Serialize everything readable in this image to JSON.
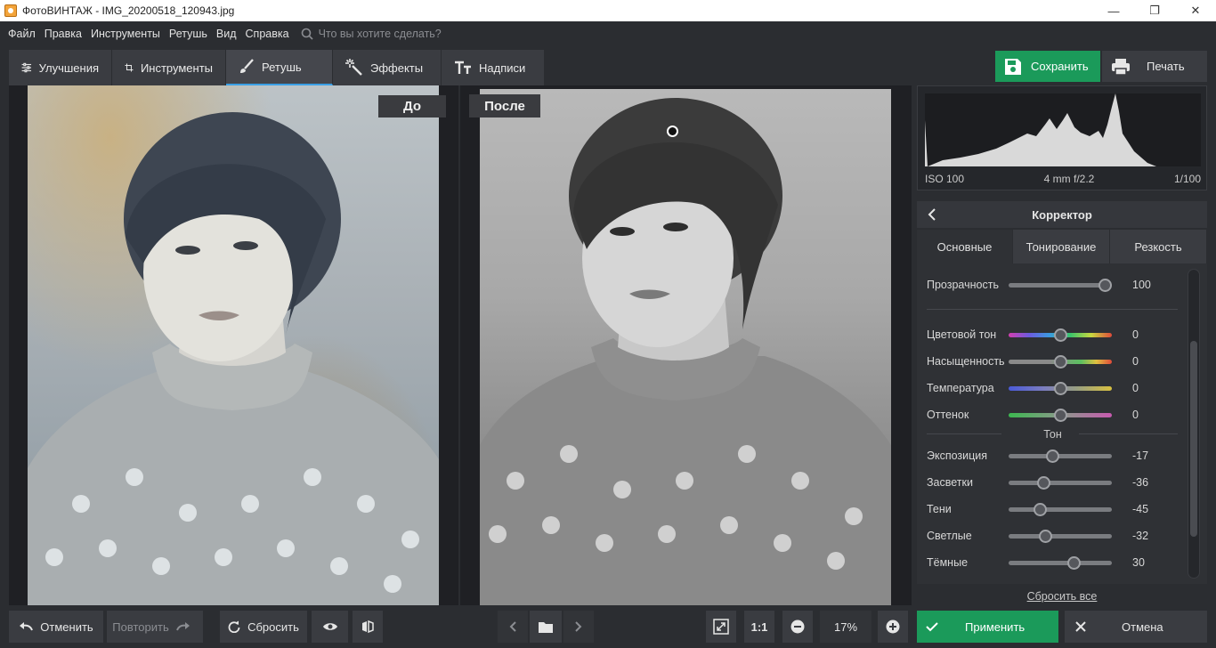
{
  "window": {
    "title": "ФотоВИНТАЖ - IMG_20200518_120943.jpg",
    "minimize": "—",
    "maximize": "❐",
    "close": "✕"
  },
  "menu": {
    "items": [
      "Файл",
      "Правка",
      "Инструменты",
      "Ретушь",
      "Вид",
      "Справка"
    ],
    "search_placeholder": "Что вы хотите сделать?"
  },
  "tabs": [
    {
      "label": "Улучшения",
      "icon": "sliders-icon"
    },
    {
      "label": "Инструменты",
      "icon": "crop-icon"
    },
    {
      "label": "Ретушь",
      "icon": "brush-icon",
      "active": true
    },
    {
      "label": "Эффекты",
      "icon": "magic-wand-icon"
    },
    {
      "label": "Надписи",
      "icon": "text-icon"
    }
  ],
  "toolbar": {
    "save_label": "Сохранить",
    "print_label": "Печать"
  },
  "canvas": {
    "before_label": "До",
    "after_label": "После"
  },
  "histogram": {
    "iso": "ISO 100",
    "lens": "4 mm f/2.2",
    "shutter": "1/100"
  },
  "corrector": {
    "title": "Корректор",
    "subtabs": [
      "Основные",
      "Тонирование",
      "Резкость"
    ],
    "active_subtab": 0,
    "opacity": {
      "label": "Прозрачность",
      "value": "100",
      "fraction": 1.0
    },
    "color": [
      {
        "label": "Цветовой тон",
        "value": "0",
        "fraction": 0.5,
        "gradient": "hue"
      },
      {
        "label": "Насыщенность",
        "value": "0",
        "fraction": 0.5,
        "gradient": "saturation"
      },
      {
        "label": "Температура",
        "value": "0",
        "fraction": 0.5,
        "gradient": "temperature"
      },
      {
        "label": "Оттенок",
        "value": "0",
        "fraction": 0.5,
        "gradient": "tint"
      }
    ],
    "tone_section_label": "Тон",
    "tone": [
      {
        "label": "Экспозиция",
        "value": "-17",
        "fraction": 0.415
      },
      {
        "label": "Засветки",
        "value": "-36",
        "fraction": 0.32
      },
      {
        "label": "Тени",
        "value": "-45",
        "fraction": 0.275
      },
      {
        "label": "Светлые",
        "value": "-32",
        "fraction": 0.34
      },
      {
        "label": "Тёмные",
        "value": "30",
        "fraction": 0.65
      }
    ],
    "reset_all_label": "Сбросить все"
  },
  "bottom": {
    "undo_label": "Отменить",
    "redo_label": "Повторить",
    "reset_label": "Сбросить",
    "zoom_1to1": "1:1",
    "zoom_value": "17%",
    "apply_label": "Применить",
    "cancel_label": "Отмена"
  },
  "colors": {
    "accent_green": "#1b9a5a",
    "active_tab_underline": "#3aa0e6",
    "panel_bg": "#2b2d31"
  }
}
